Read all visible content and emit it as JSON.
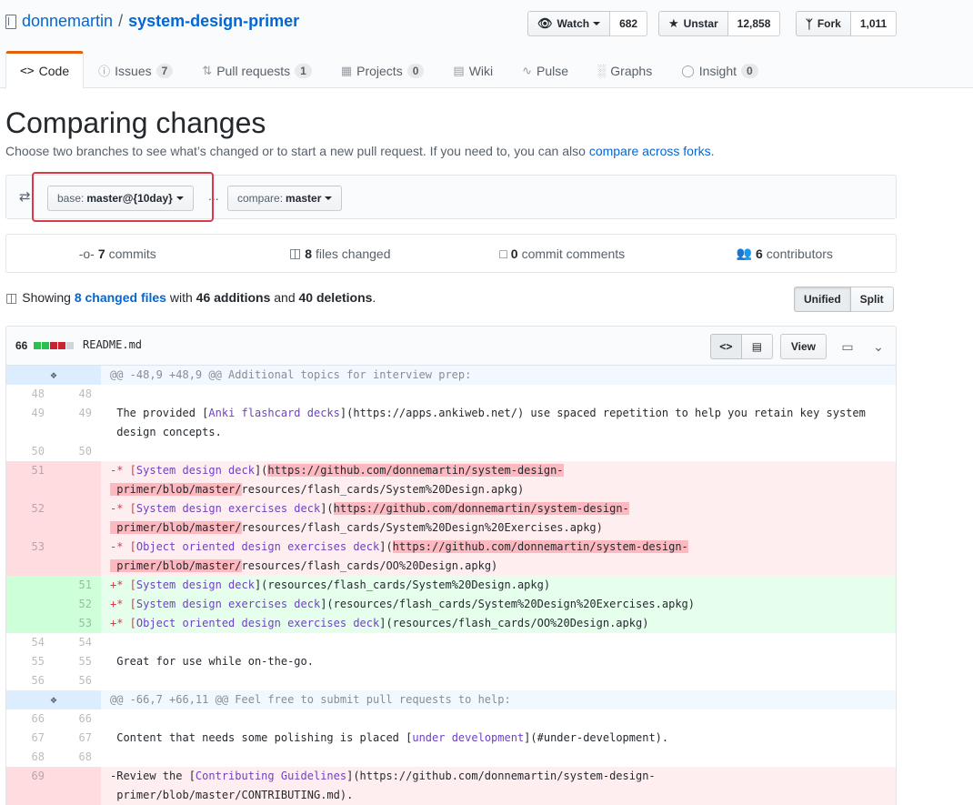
{
  "repo": {
    "owner": "donnemartin",
    "separator": "/",
    "name": "system-design-primer"
  },
  "actions": {
    "watch": {
      "label": "Watch",
      "count": "682"
    },
    "unstar": {
      "label": "Unstar",
      "count": "12,858"
    },
    "fork": {
      "label": "Fork",
      "count": "1,011"
    }
  },
  "nav": {
    "code": "Code",
    "issues": {
      "label": "Issues",
      "count": "7"
    },
    "pulls": {
      "label": "Pull requests",
      "count": "1"
    },
    "projects": {
      "label": "Projects",
      "count": "0"
    },
    "wiki": "Wiki",
    "pulse": "Pulse",
    "graphs": "Graphs",
    "insight": {
      "label": "Insight",
      "count": "0"
    }
  },
  "title": "Comparing changes",
  "subtitle": {
    "text": "Choose two branches to see what’s changed or to start a new pull request. If you need to, you can also ",
    "link": "compare across forks",
    "end": "."
  },
  "range": {
    "base_label": "base:",
    "base_value": "master@{10day}",
    "dots": "...",
    "compare_label": "compare:",
    "compare_value": "master"
  },
  "summary": {
    "commits": {
      "count": "7",
      "label": "commits"
    },
    "files": {
      "count": "8",
      "label": "files changed"
    },
    "comments": {
      "count": "0",
      "label": "commit comments"
    },
    "contributors": {
      "count": "6",
      "label": "contributors"
    }
  },
  "toc": {
    "prefix": "Showing ",
    "link": "8 changed files",
    "mid": " with ",
    "additions": "46 additions",
    "and": " and ",
    "deletions": "40 deletions",
    "end": "."
  },
  "view_toggle": {
    "unified": "Unified",
    "split": "Split"
  },
  "file": {
    "stat": "66",
    "name": "README.md",
    "view_label": "View",
    "hunk1": "@@ -48,9 +48,9 @@ Additional topics for interview prep:",
    "hunk2": "@@ -66,7 +66,11 @@ Feel free to submit pull requests to help:",
    "lines": {
      "l48": {
        "o": "48",
        "n": "48"
      },
      "l49": {
        "o": "49",
        "n": "49",
        "a": " The provided [",
        "b": "Anki flashcard decks",
        "c": "](https://apps.ankiweb.net/) use spaced repetition to help you retain key system\n design concepts."
      },
      "l50": {
        "o": "50",
        "n": "50"
      },
      "d51": {
        "o": "51",
        "pre": "-* [",
        "t": "System design deck",
        "m": "](",
        "x": "https://github.com/donnemartin/system-design-\n primer/blob/master/",
        "r": "resources/flash_cards/System%20Design.apkg)"
      },
      "d52": {
        "o": "52",
        "pre": "-* [",
        "t": "System design exercises deck",
        "m": "](",
        "x": "https://github.com/donnemartin/system-design-\n primer/blob/master/",
        "r": "resources/flash_cards/System%20Design%20Exercises.apkg)"
      },
      "d53": {
        "o": "53",
        "pre": "-* [",
        "t": "Object oriented design exercises deck",
        "m": "](",
        "x": "https://github.com/donnemartin/system-design-\n primer/blob/master/",
        "r": "resources/flash_cards/OO%20Design.apkg)"
      },
      "a51": {
        "n": "51",
        "pre": "+* [",
        "t": "System design deck",
        "r": "](resources/flash_cards/System%20Design.apkg)"
      },
      "a52": {
        "n": "52",
        "pre": "+* [",
        "t": "System design exercises deck",
        "r": "](resources/flash_cards/System%20Design%20Exercises.apkg)"
      },
      "a53": {
        "n": "53",
        "pre": "+* [",
        "t": "Object oriented design exercises deck",
        "r": "](resources/flash_cards/OO%20Design.apkg)"
      },
      "l54": {
        "o": "54",
        "n": "54"
      },
      "l55": {
        "o": "55",
        "n": "55",
        "a": " Great for use while on-the-go."
      },
      "l56": {
        "o": "56",
        "n": "56"
      },
      "l66": {
        "o": "66",
        "n": "66"
      },
      "l67": {
        "o": "67",
        "n": "67",
        "a": " Content that needs some polishing is placed [",
        "b": "under development",
        "c": "](#under-development)."
      },
      "l68": {
        "o": "68",
        "n": "68"
      },
      "d69": {
        "o": "69",
        "pre": "-Review the [",
        "t": "Contributing Guidelines",
        "r": "](https://github.com/donnemartin/system-design-\n primer/blob/master/CONTRIBUTING.md)."
      }
    }
  },
  "colors": {
    "accent": "#0366d6",
    "tab_highlight": "#e36209",
    "callout": "#d73a49",
    "add": "#2cbe4e",
    "del": "#cb2431"
  }
}
